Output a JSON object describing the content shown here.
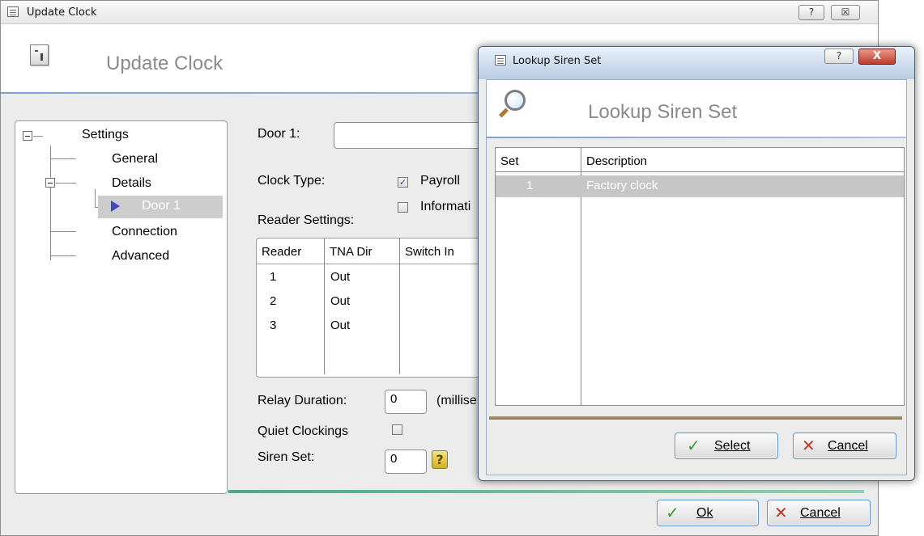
{
  "main_window": {
    "title": "Update Clock",
    "help_button": "?",
    "close_button": "☒",
    "header_title": "Update Clock"
  },
  "tree": {
    "root": "Settings",
    "general": "General",
    "details": "Details",
    "door1": "Door 1",
    "connection": "Connection",
    "advanced": "Advanced"
  },
  "form": {
    "door_label": "Door 1:",
    "door_value": "",
    "clock_type_label": "Clock Type:",
    "payroll_label": "Payroll",
    "payroll_checked": true,
    "information_label": "Informati",
    "information_checked": false,
    "reader_settings_label": "Reader Settings:",
    "relay_label": "Relay Duration:",
    "relay_value": "0",
    "relay_unit": "(millise",
    "quiet_label": "Quiet Clockings",
    "quiet_checked": false,
    "siren_label": "Siren Set:",
    "siren_value": "0",
    "siren_help": "?"
  },
  "reader_grid": {
    "headers": [
      "Reader",
      "TNA Dir",
      "Switch In"
    ],
    "rows": [
      {
        "reader": "1",
        "tna_dir": "Out",
        "switch_in": ""
      },
      {
        "reader": "2",
        "tna_dir": "Out",
        "switch_in": ""
      },
      {
        "reader": "3",
        "tna_dir": "Out",
        "switch_in": ""
      }
    ]
  },
  "main_buttons": {
    "ok": "Ok",
    "cancel": "Cancel"
  },
  "lookup": {
    "title": "Lookup Siren Set",
    "help_button": "?",
    "close_button": "X",
    "header_title": "Lookup Siren Set",
    "headers": [
      "Set",
      "Description"
    ],
    "rows": [
      {
        "set": "1",
        "description": "Factory clock",
        "selected": true
      }
    ],
    "select_button": "Select",
    "cancel_button": "Cancel"
  },
  "colors": {
    "accent_blue": "#7ea2d6",
    "footer_green": "#4ea885",
    "check_icon": "#3a9a2e",
    "cancel_icon": "#c0392b"
  }
}
